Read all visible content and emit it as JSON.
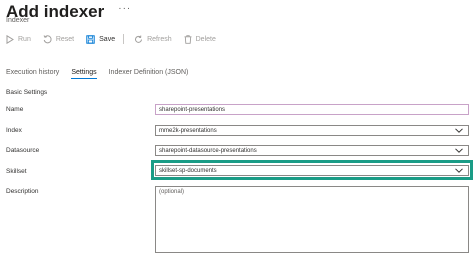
{
  "header": {
    "title": "Add indexer",
    "more_label": "···",
    "subtitle": "Indexer"
  },
  "toolbar": {
    "run_label": "Run",
    "reset_label": "Reset",
    "save_label": "Save",
    "refresh_label": "Refresh",
    "delete_label": "Delete"
  },
  "tabs": [
    {
      "label": "Execution history",
      "active": false
    },
    {
      "label": "Settings",
      "active": true
    },
    {
      "label": "Indexer Definition (JSON)",
      "active": false
    }
  ],
  "form": {
    "section_title": "Basic Settings",
    "name": {
      "label": "Name",
      "value": "sharepoint-presentations"
    },
    "index": {
      "label": "Index",
      "value": "mme2k-presentations"
    },
    "datasource": {
      "label": "Datasource",
      "value": "sharepoint-datasource-presentations"
    },
    "skillset": {
      "label": "Skillset",
      "value": "skillset-sp-documents"
    },
    "description": {
      "label": "Description",
      "placeholder": "(optional)"
    }
  },
  "colors": {
    "highlight": "#1a9c86",
    "accent": "#0078d4"
  }
}
